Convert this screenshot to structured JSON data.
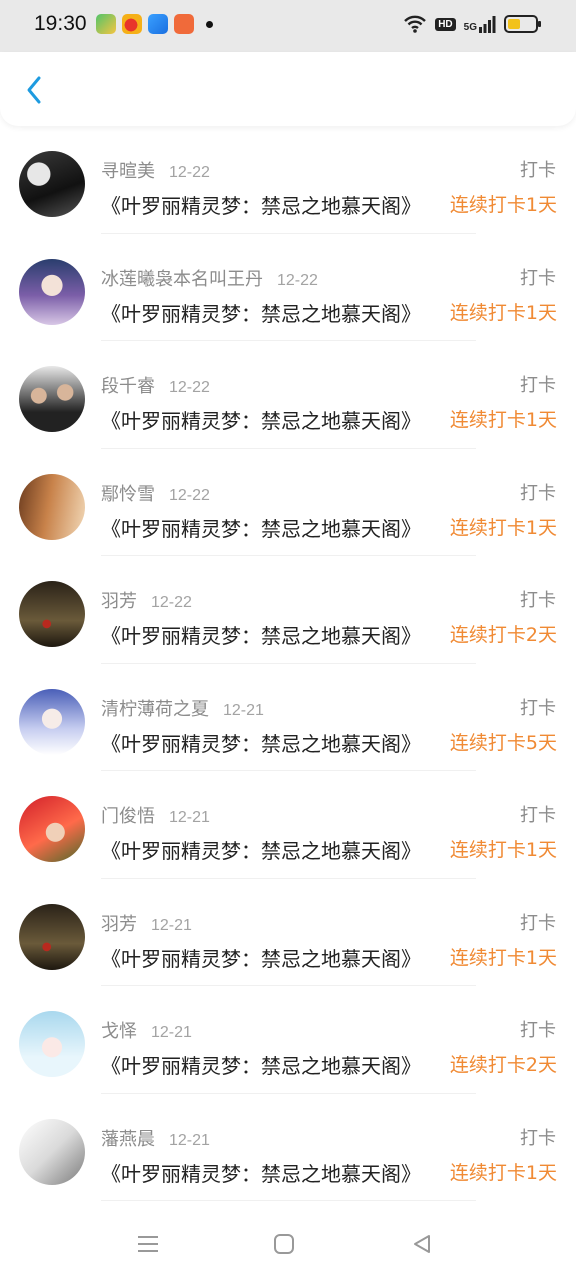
{
  "status_bar": {
    "time": "19:30",
    "hd_label": "HD",
    "network_label": "5G",
    "battery_level": 0.45
  },
  "colors": {
    "accent": "#f08a34",
    "back_arrow": "#1e9be0",
    "battery": "#f2c21b"
  },
  "header": {
    "back_icon": "chevron-left-icon"
  },
  "entries": [
    {
      "name": "寻暄美",
      "date": "12-22",
      "action": "打卡",
      "book": "《叶罗丽精灵梦：禁忌之地慕天阁》",
      "streak": "连续打卡1天"
    },
    {
      "name": "冰莲曦袅本名叫王丹",
      "date": "12-22",
      "action": "打卡",
      "book": "《叶罗丽精灵梦：禁忌之地慕天阁》",
      "streak": "连续打卡1天"
    },
    {
      "name": "段千睿",
      "date": "12-22",
      "action": "打卡",
      "book": "《叶罗丽精灵梦：禁忌之地慕天阁》",
      "streak": "连续打卡1天"
    },
    {
      "name": "鄢怜雪",
      "date": "12-22",
      "action": "打卡",
      "book": "《叶罗丽精灵梦：禁忌之地慕天阁》",
      "streak": "连续打卡1天"
    },
    {
      "name": "羽芳",
      "date": "12-22",
      "action": "打卡",
      "book": "《叶罗丽精灵梦：禁忌之地慕天阁》",
      "streak": "连续打卡2天"
    },
    {
      "name": "清柠薄荷之夏",
      "date": "12-21",
      "action": "打卡",
      "book": "《叶罗丽精灵梦：禁忌之地慕天阁》",
      "streak": "连续打卡5天"
    },
    {
      "name": "门俊悟",
      "date": "12-21",
      "action": "打卡",
      "book": "《叶罗丽精灵梦：禁忌之地慕天阁》",
      "streak": "连续打卡1天"
    },
    {
      "name": "羽芳",
      "date": "12-21",
      "action": "打卡",
      "book": "《叶罗丽精灵梦：禁忌之地慕天阁》",
      "streak": "连续打卡1天"
    },
    {
      "name": "戈怿",
      "date": "12-21",
      "action": "打卡",
      "book": "《叶罗丽精灵梦：禁忌之地慕天阁》",
      "streak": "连续打卡2天"
    },
    {
      "name": "藩燕晨",
      "date": "12-21",
      "action": "打卡",
      "book": "《叶罗丽精灵梦：禁忌之地慕天阁》",
      "streak": "连续打卡1天"
    }
  ],
  "bottom_nav": {
    "menu": "menu-icon",
    "home": "home-square-icon",
    "back": "back-triangle-icon"
  }
}
